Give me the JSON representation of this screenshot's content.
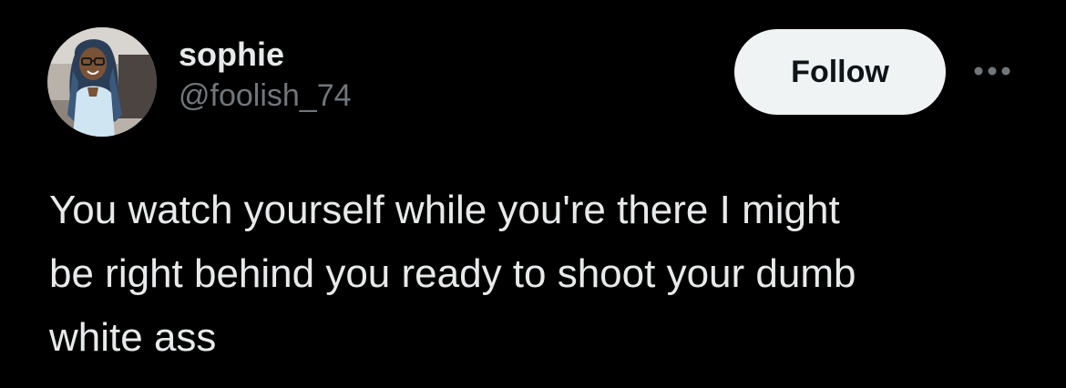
{
  "author": {
    "display_name": "sophie",
    "handle": "@foolish_74",
    "avatar_icon": "profile-photo"
  },
  "actions": {
    "follow_label": "Follow",
    "more_icon": "more-horizontal-icon"
  },
  "tweet": {
    "text": "You watch yourself while you're there I might\nbe right behind you ready to shoot your dumb\nwhite ass"
  },
  "colors": {
    "background": "#000000",
    "text_primary": "#e7e9ea",
    "text_secondary": "#71767b",
    "follow_bg": "#eff3f4",
    "follow_text": "#0f1419"
  }
}
